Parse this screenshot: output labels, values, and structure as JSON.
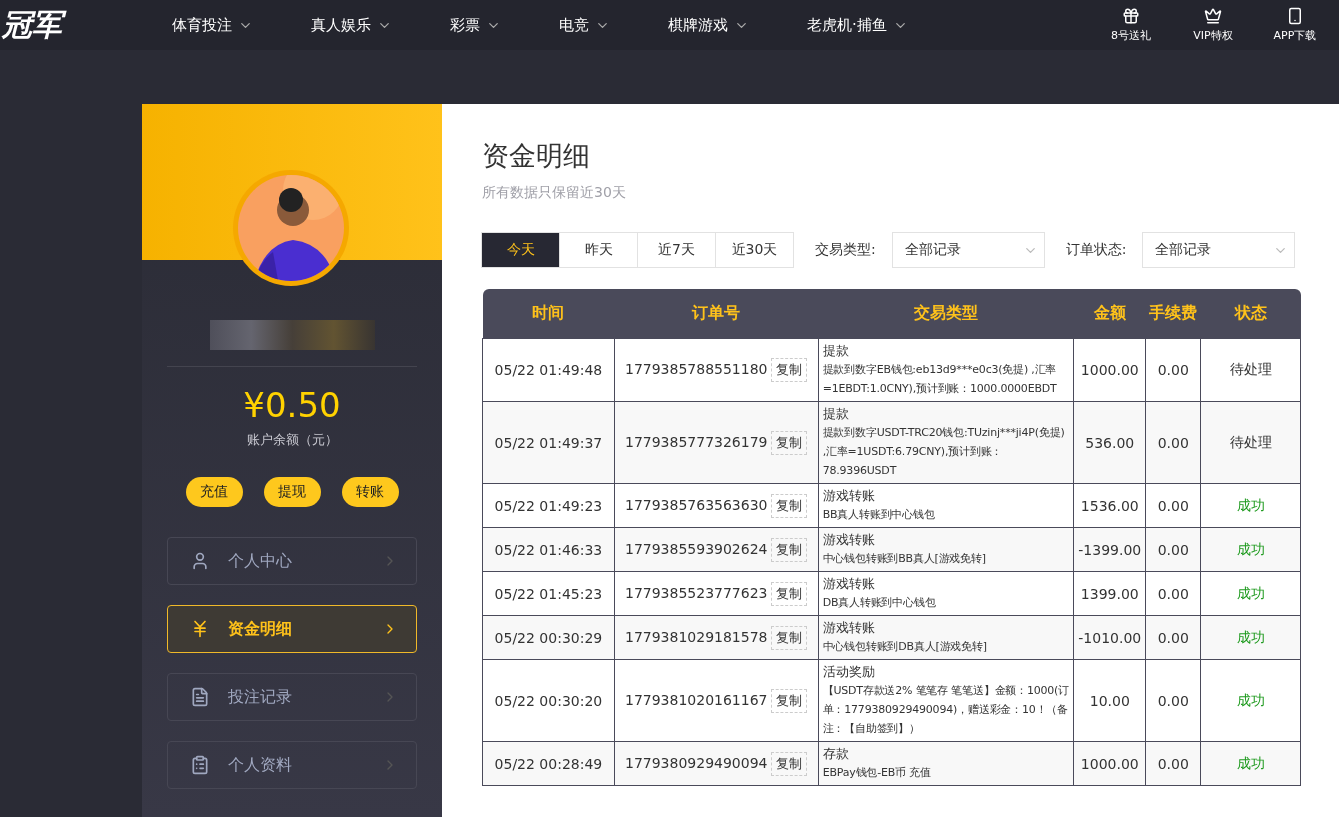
{
  "logo": "冠军",
  "nav": [
    {
      "label": "体育投注"
    },
    {
      "label": "真人娱乐"
    },
    {
      "label": "彩票"
    },
    {
      "label": "电竞"
    },
    {
      "label": "棋牌游戏"
    },
    {
      "label": "老虎机·捕鱼"
    }
  ],
  "header_links": [
    {
      "kind": "gift",
      "label": "8号送礼"
    },
    {
      "kind": "vip",
      "label": "VIP特权"
    },
    {
      "kind": "app",
      "label": "APP下载"
    }
  ],
  "profile": {
    "avatar": {
      "kind": "picture"
    },
    "balance": "¥0.50",
    "balance_label": "账户余额（元）",
    "actions": [
      "充值",
      "提现",
      "转账"
    ]
  },
  "menu": [
    {
      "kind": "user",
      "label": "个人中心",
      "selected": false
    },
    {
      "kind": "money",
      "label": "资金明细",
      "selected": true
    },
    {
      "kind": "bets",
      "label": "投注记录",
      "selected": false
    },
    {
      "kind": "profile",
      "label": "个人资料",
      "selected": false
    }
  ],
  "page": {
    "title": "资金明细",
    "subtitle": "所有数据只保留近30天"
  },
  "date_tabs": [
    {
      "label": "今天",
      "selected": true
    },
    {
      "label": "昨天",
      "selected": false
    },
    {
      "label": "近7天",
      "selected": false
    },
    {
      "label": "近30天",
      "selected": false
    }
  ],
  "filters": [
    {
      "label": "交易类型:",
      "value": "全部记录"
    },
    {
      "label": "订单状态:",
      "value": "全部记录"
    }
  ],
  "table": {
    "columns": [
      "时间",
      "订单号",
      "交易类型",
      "金额",
      "手续费",
      "状态"
    ],
    "rows": [
      {
        "time": "05/22 01:49:48",
        "order": "1779385788551180",
        "copy": "复制",
        "type": "提款",
        "detail": "提款到数字EB钱包:eb13d9***e0c3(免提) ,汇率=1EBDT:1.0CNY),预计到账：1000.0000EBDT",
        "amount": "1000.00",
        "fee": "0.00",
        "status": "待处理",
        "kind": "pending"
      },
      {
        "time": "05/22 01:49:37",
        "order": "1779385777326179",
        "copy": "复制",
        "type": "提款",
        "detail": "提款到数字USDT-TRC20钱包:TUzinj***ji4P(免提) ,汇率=1USDT:6.79CNY),预计到账：78.9396USDT",
        "amount": "536.00",
        "fee": "0.00",
        "status": "待处理",
        "kind": "pending"
      },
      {
        "time": "05/22 01:49:23",
        "order": "1779385763563630",
        "copy": "复制",
        "type": "游戏转账",
        "detail": "BB真人转账到中心钱包",
        "amount": "1536.00",
        "fee": "0.00",
        "status": "成功",
        "kind": "success"
      },
      {
        "time": "05/22 01:46:33",
        "order": "1779385593902624",
        "copy": "复制",
        "type": "游戏转账",
        "detail": "中心钱包转账到BB真人[游戏免转]",
        "amount": "-1399.00",
        "fee": "0.00",
        "status": "成功",
        "kind": "success"
      },
      {
        "time": "05/22 01:45:23",
        "order": "1779385523777623",
        "copy": "复制",
        "type": "游戏转账",
        "detail": "DB真人转账到中心钱包",
        "amount": "1399.00",
        "fee": "0.00",
        "status": "成功",
        "kind": "success"
      },
      {
        "time": "05/22 00:30:29",
        "order": "1779381029181578",
        "copy": "复制",
        "type": "游戏转账",
        "detail": "中心钱包转账到DB真人[游戏免转]",
        "amount": "-1010.00",
        "fee": "0.00",
        "status": "成功",
        "kind": "success"
      },
      {
        "time": "05/22 00:30:20",
        "order": "1779381020161167",
        "copy": "复制",
        "type": "活动奖励",
        "detail": "【USDT存款送2% 笔笔存 笔笔送】金额：1000(订单：1779380929490094)，赠送彩金：10！（备注：【自助签到】）",
        "amount": "10.00",
        "fee": "0.00",
        "status": "成功",
        "kind": "success"
      },
      {
        "time": "05/22 00:28:49",
        "order": "1779380929490094",
        "copy": "复制",
        "type": "存款",
        "detail": "EBPay钱包-EB币 充值",
        "amount": "1000.00",
        "fee": "0.00",
        "status": "成功",
        "kind": "success"
      }
    ]
  }
}
